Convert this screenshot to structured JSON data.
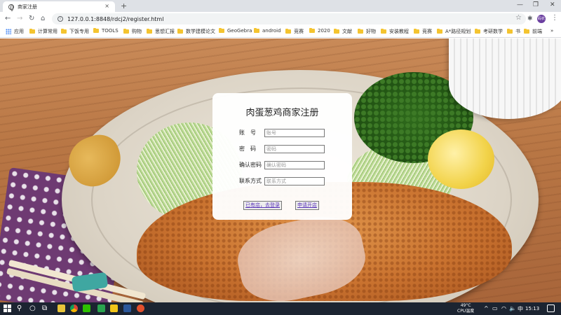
{
  "browser": {
    "tab_title": "商家注册",
    "tab_close": "×",
    "new_tab": "+",
    "window_controls": [
      "—",
      "❐",
      "✕"
    ],
    "url": "127.0.0.1:8848/rdcj2/register.html",
    "nav_back": "←",
    "nav_forward": "→",
    "nav_reload": "↻",
    "nav_home": "⌂",
    "star": "☆",
    "extensions": "✱",
    "profile": "码农",
    "menu": "⋮"
  },
  "bookmarks": {
    "apps_label": "应用",
    "items": [
      "计算常用",
      "下饭专用",
      "TOOLS",
      "购物",
      "思想汇报",
      "数学建模论文",
      "GeoGebra",
      "android",
      "竞赛",
      "2020",
      "文献",
      "好物",
      "安装教程",
      "竞赛",
      "A*路径规划",
      "考研数学",
      "书",
      "前端"
    ],
    "more": "»"
  },
  "form": {
    "title": "肉蛋葱鸡商家注册",
    "account_label": "账　号",
    "account_placeholder": "账号",
    "password_label": "密　码",
    "password_placeholder": "密码",
    "confirm_label": "确认密码",
    "confirm_placeholder": "确认密码",
    "contact_label": "联系方式",
    "contact_placeholder": "联系方式",
    "login_button": "已有店，去登录",
    "register_button": "申请开店"
  },
  "taskbar": {
    "search_glyph": "⚲",
    "cortana_glyph": "○",
    "taskview_glyph": "⧉",
    "temperature": "49°C",
    "cpu_label": "CPU温度",
    "caret": "^",
    "tray_glyphs": [
      "▭",
      "◠",
      "🔈",
      "中"
    ],
    "time": "15:13"
  }
}
